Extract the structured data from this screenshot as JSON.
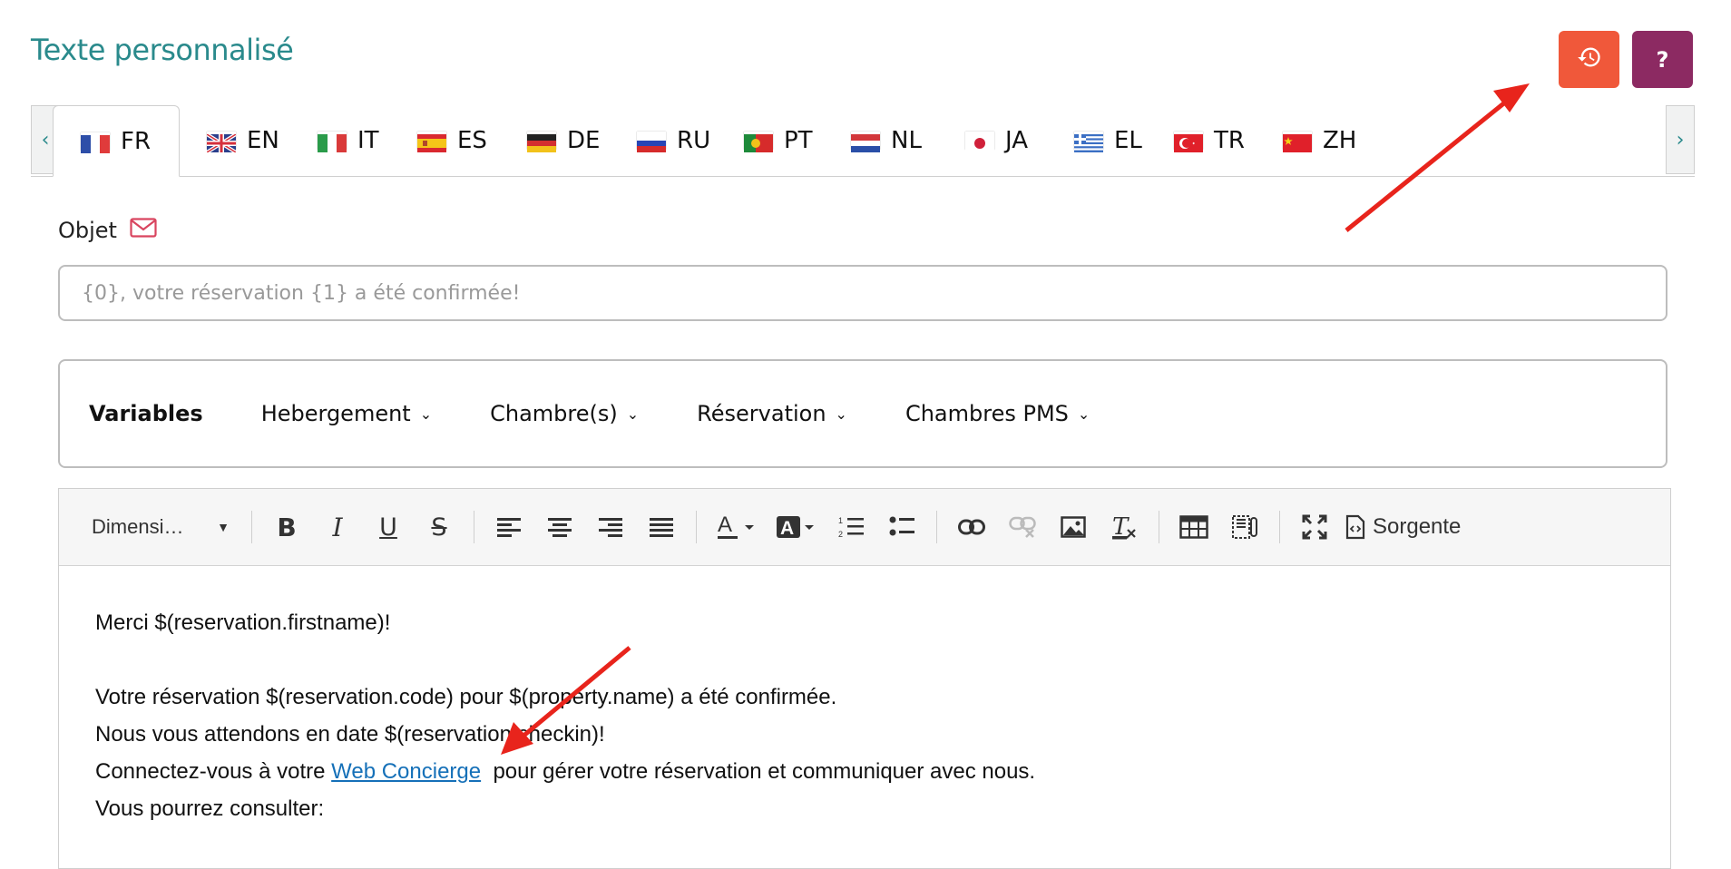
{
  "header": {
    "title": "Texte personnalisé",
    "help_label": "?"
  },
  "tabs": [
    {
      "code": "FR",
      "flag": "fr"
    },
    {
      "code": "EN",
      "flag": "en"
    },
    {
      "code": "IT",
      "flag": "it"
    },
    {
      "code": "ES",
      "flag": "es"
    },
    {
      "code": "DE",
      "flag": "de"
    },
    {
      "code": "RU",
      "flag": "ru"
    },
    {
      "code": "PT",
      "flag": "pt"
    },
    {
      "code": "NL",
      "flag": "nl"
    },
    {
      "code": "JA",
      "flag": "ja"
    },
    {
      "code": "EL",
      "flag": "el"
    },
    {
      "code": "TR",
      "flag": "tr"
    },
    {
      "code": "ZH",
      "flag": "zh"
    }
  ],
  "active_tab": "FR",
  "objet": {
    "label": "Objet",
    "placeholder": "{0}, votre réservation {1} a été confirmée!"
  },
  "variables": {
    "title": "Variables",
    "menus": [
      "Hebergement",
      "Chambre(s)",
      "Réservation",
      "Chambres PMS"
    ]
  },
  "toolbar": {
    "size_select": "Dimensi…",
    "source_label": "Sorgente"
  },
  "content": {
    "line1": "Merci $(reservation.firstname)!",
    "line2": "Votre réservation $(reservation.code) pour $(property.name) a été confirmée.",
    "line3": "Nous vous attendons en date $(reservation.checkin)!",
    "line4_before": "Connectez-vous à votre ",
    "line4_link": "Web Concierge",
    "line4_after": "  pour gérer votre réservation et communiquer avec nous.",
    "line5": "Vous pourrez consulter:"
  },
  "colors": {
    "title": "#2a8a8c",
    "history_button": "#f0583a",
    "help_button": "#8c2a62",
    "link": "#1570b8",
    "annotation_arrow": "#e8241c"
  }
}
